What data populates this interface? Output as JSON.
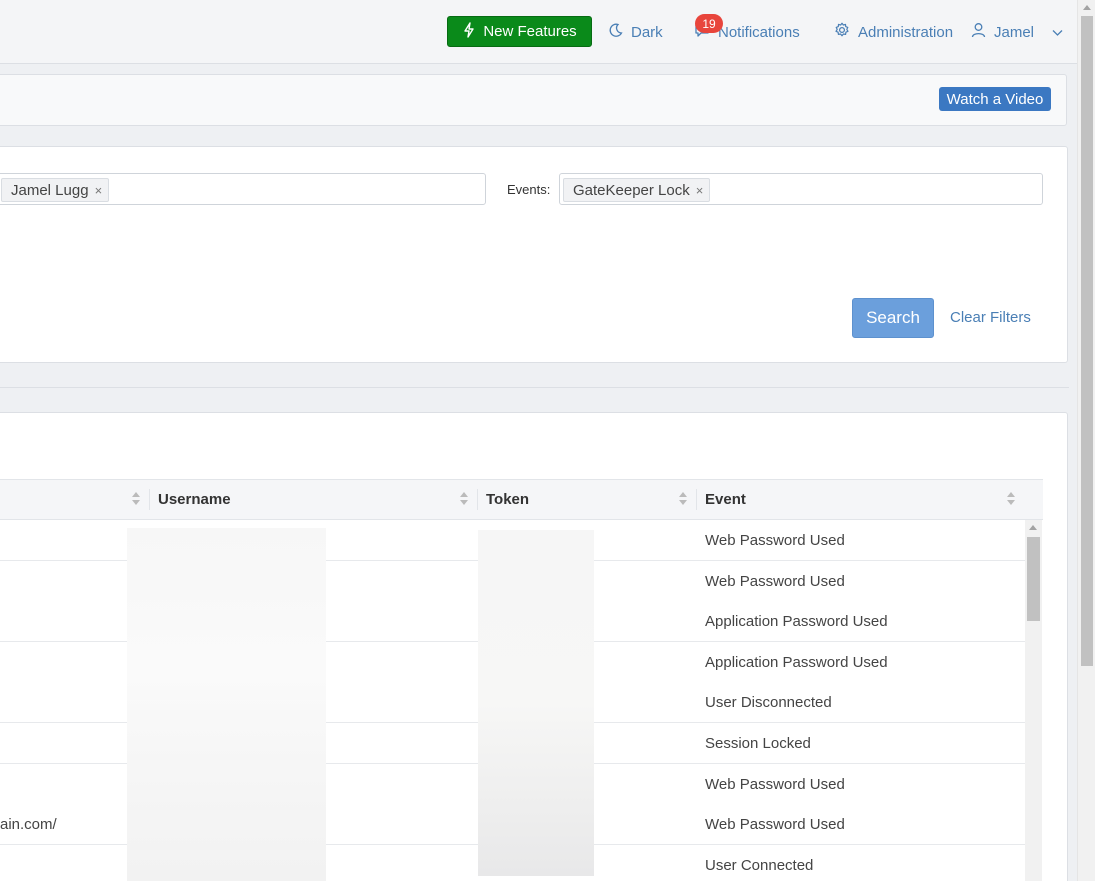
{
  "header": {
    "new_features_label": "New Features",
    "dark_label": "Dark",
    "notifications_label": "Notifications",
    "notifications_count": "19",
    "administration_label": "Administration",
    "user_label": "Jamel"
  },
  "banner": {
    "watch_video_label": "Watch a Video"
  },
  "filters": {
    "user_tag": "Jamel Lugg",
    "events_label": "Events:",
    "events_tag": "GateKeeper Lock",
    "tag_remove": "×",
    "search_label": "Search",
    "clear_label": "Clear Filters"
  },
  "table": {
    "columns": [
      "Username",
      "Token",
      "Event"
    ],
    "rows": [
      {
        "partial": "",
        "event": "Web Password Used"
      },
      {
        "partial": "",
        "event": "Web Password Used"
      },
      {
        "partial": "",
        "event": "Application Password Used"
      },
      {
        "partial": "",
        "event": "Application Password Used"
      },
      {
        "partial": "",
        "event": "User Disconnected"
      },
      {
        "partial": "",
        "event": "Session Locked"
      },
      {
        "partial": "",
        "event": "Web Password Used"
      },
      {
        "partial": "ain.com/",
        "event": "Web Password Used"
      },
      {
        "partial": "",
        "event": "User Connected"
      }
    ]
  },
  "colors": {
    "accent": "#4a7fb5",
    "new_features_bg": "#0a8a1a",
    "badge": "#e8453c",
    "search_button": "#6b9fdc",
    "watch_button": "#3b78c2"
  }
}
